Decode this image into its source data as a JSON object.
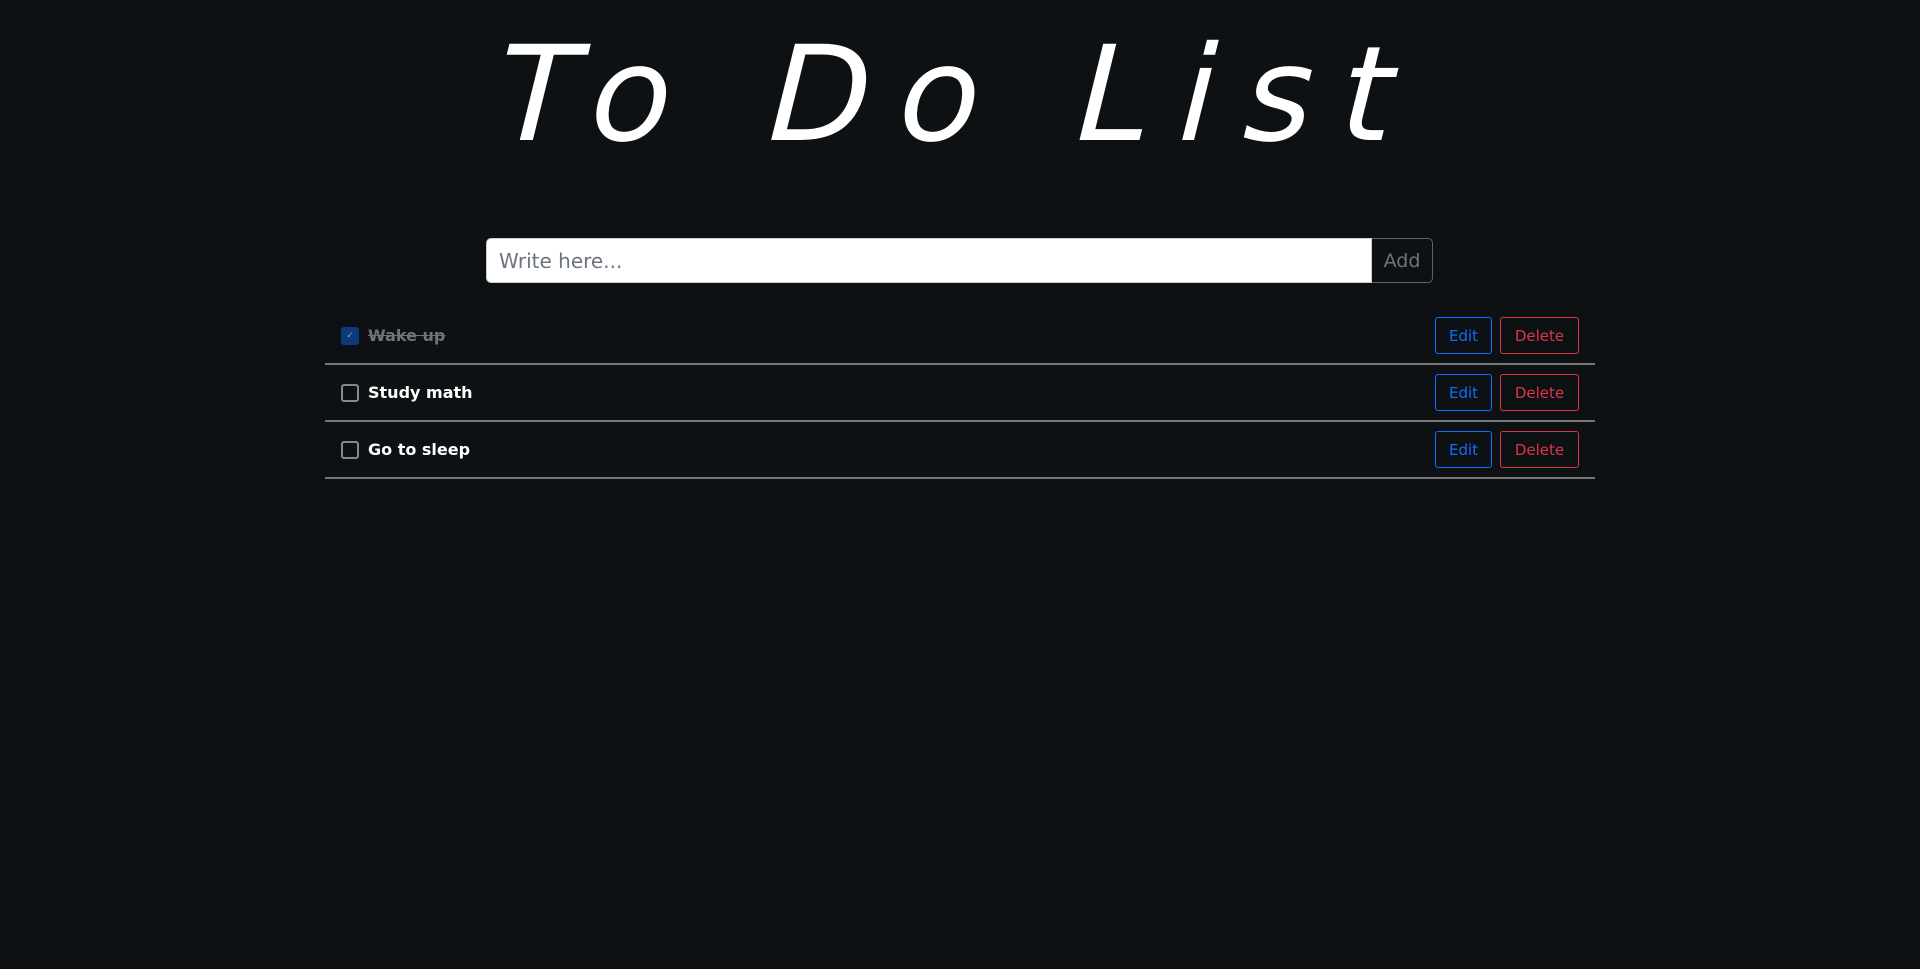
{
  "title": "To Do List",
  "form": {
    "placeholder": "Write here...",
    "add_label": "Add"
  },
  "todos": [
    {
      "text": "Wake up",
      "done": true,
      "edit_label": "Edit",
      "delete_label": "Delete"
    },
    {
      "text": "Study math",
      "done": false,
      "edit_label": "Edit",
      "delete_label": "Delete"
    },
    {
      "text": "Go to sleep",
      "done": false,
      "edit_label": "Edit",
      "delete_label": "Delete"
    }
  ],
  "colors": {
    "background": "#0e1113",
    "edit": "#0d6efd",
    "delete": "#dc3545",
    "checked": "#0d3a7a"
  }
}
